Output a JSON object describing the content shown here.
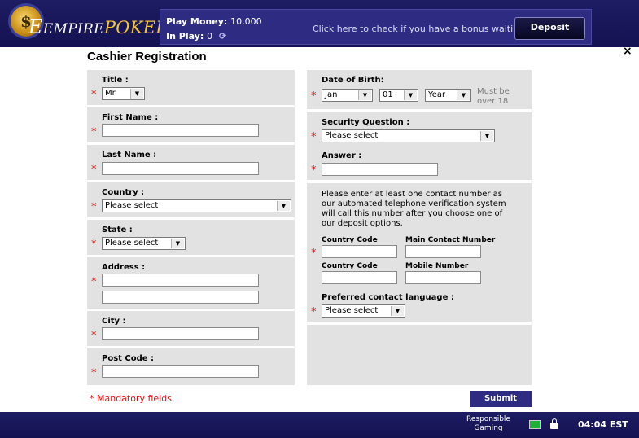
{
  "brand": {
    "coin_symbol": "$",
    "logo_first": "EMPIRE",
    "logo_second": "POKER"
  },
  "header": {
    "play_money_label": "Play Money:",
    "play_money_value": "10,000",
    "in_play_label": "In Play:",
    "in_play_value": "0",
    "bonus_link": "Click here to check if you have a bonus waiting.",
    "deposit_label": "Deposit"
  },
  "form": {
    "title": "Cashier Registration",
    "close_symbol": "×",
    "required_mark": "*",
    "title_field": {
      "label": "Title :",
      "selected": "Mr"
    },
    "first_name": {
      "label": "First Name :",
      "value": ""
    },
    "last_name": {
      "label": "Last Name :",
      "value": ""
    },
    "country": {
      "label": "Country :",
      "selected": "Please select"
    },
    "state": {
      "label": "State :",
      "selected": "Please select"
    },
    "address": {
      "label": "Address :",
      "line1": "",
      "line2": ""
    },
    "city": {
      "label": "City :",
      "value": ""
    },
    "post_code": {
      "label": "Post Code :",
      "value": ""
    },
    "dob": {
      "label": "Date of Birth:",
      "month": "Jan",
      "day": "01",
      "year": "Year",
      "note_line1": "Must be",
      "note_line2": "over 18"
    },
    "security_question": {
      "label": "Security Question :",
      "selected": "Please select"
    },
    "answer": {
      "label": "Answer :",
      "value": ""
    },
    "contact_info": [
      "Please enter at least one contact number as",
      "our automated telephone verification system",
      "will call this number after you choose one of",
      "our deposit options."
    ],
    "country_code_label_1": "Country Code",
    "main_contact_label": "Main Contact Number",
    "country_code_label_2": "Country Code",
    "mobile_label": "Mobile Number",
    "language": {
      "label": "Preferred contact language :",
      "selected": "Please select"
    },
    "mandatory_note": "* Mandatory fields",
    "submit_label": "Submit"
  },
  "footer": {
    "responsible_line1": "Responsible",
    "responsible_line2": "Gaming",
    "time": "04:04 EST"
  },
  "colors": {
    "header_bg": "#1e1c63",
    "accent": "#2e2c82",
    "required": "#e01010",
    "logo_gold": "#f3c637",
    "panel_bg": "#e2e2e2"
  },
  "icons": [
    "coin-icon",
    "refresh-icon",
    "close-icon",
    "chevron-down-icon",
    "monitor-icon",
    "lock-icon"
  ]
}
